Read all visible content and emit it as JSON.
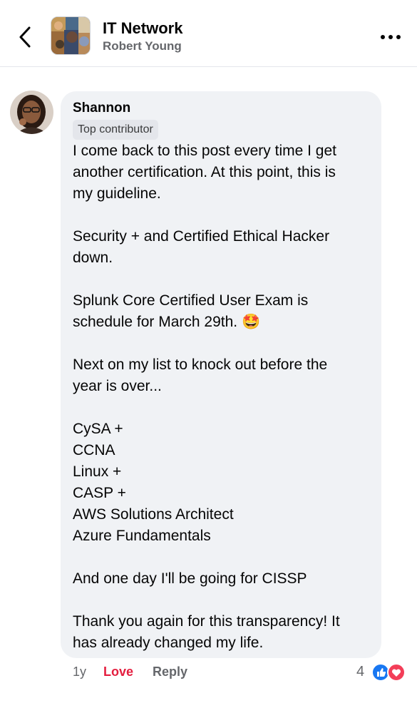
{
  "header": {
    "title": "IT Network",
    "subtitle": "Robert Young",
    "icons": {
      "back": "chevron-left-icon",
      "more": "more-horizontal-icon"
    }
  },
  "comment": {
    "author": "Shannon",
    "badge": "Top contributor",
    "paragraphs": [
      "I come back to this post every time I get",
      "another certification. At this point, this is",
      "my guideline.",
      "",
      "Security + and Certified Ethical Hacker",
      "down.",
      "",
      "Splunk Core Certified User Exam is",
      "schedule for March 29th. 🤩",
      "",
      "Next on my list to knock out before the",
      "year is over...",
      "",
      "CySA +",
      "CCNA",
      "Linux +",
      "CASP +",
      "AWS Solutions Architect",
      "Azure Fundamentals",
      "",
      "And one day I'll be going for CISSP",
      "",
      "Thank you again for this transparency! It",
      "has already changed my life."
    ],
    "age": "1y",
    "love_label": "Love",
    "reply_label": "Reply",
    "reaction_count": "4",
    "reactions": [
      "like",
      "love"
    ]
  },
  "colors": {
    "bubble": "#f0f2f5",
    "love": "#e41e3f",
    "like_blue": "#1877f2",
    "muted": "#65676b"
  }
}
